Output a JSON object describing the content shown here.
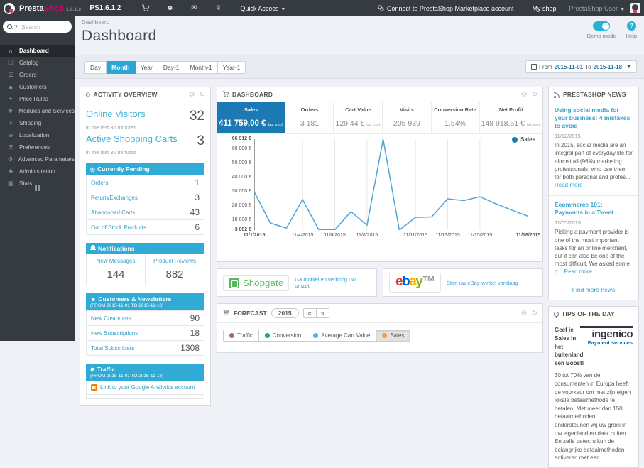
{
  "topbar": {
    "brand_presta": "Presta",
    "brand_shop": "Shop",
    "version": "1.6.1.2",
    "shop_name": "PS1.6.1.2",
    "quick_access": "Quick Access",
    "marketplace_link": "Connect to PrestaShop Marketplace account",
    "my_shop": "My shop",
    "user": "PrestaShop User"
  },
  "sidebar": {
    "search_placeholder": "Search",
    "items": [
      {
        "label": "Dashboard",
        "icon": "⌂"
      },
      {
        "label": "Catalog",
        "icon": "❏"
      },
      {
        "label": "Orders",
        "icon": "☰"
      },
      {
        "label": "Customers",
        "icon": "☻"
      },
      {
        "label": "Price Rules",
        "icon": "✦"
      },
      {
        "label": "Modules and Services",
        "icon": "❖"
      },
      {
        "label": "Shipping",
        "icon": "✈"
      },
      {
        "label": "Localization",
        "icon": "⊕"
      },
      {
        "label": "Preferences",
        "icon": "⚒"
      },
      {
        "label": "Advanced Parameters",
        "icon": "⚙"
      },
      {
        "label": "Administration",
        "icon": "✱"
      },
      {
        "label": "Stats",
        "icon": "▦"
      }
    ]
  },
  "header": {
    "breadcrumb": "Dashboard",
    "title": "Dashboard",
    "demo_mode_label": "Demo mode",
    "help_label": "Help",
    "help_glyph": "?"
  },
  "filters": {
    "buttons": [
      "Day",
      "Month",
      "Year",
      "Day-1",
      "Month-1",
      "Year-1"
    ],
    "active": "Month",
    "date_range": {
      "from_label": "From",
      "from": "2015-11-01",
      "to_label": "To",
      "to": "2015-11-18"
    }
  },
  "activity": {
    "title": "ACTIVITY OVERVIEW",
    "online_visitors": {
      "label": "Online Visitors",
      "value": "32",
      "sub": "in the last 30 minutes"
    },
    "active_carts": {
      "label": "Active Shopping Carts",
      "value": "3",
      "sub": "in the last 30 minutes"
    },
    "pending": {
      "title": "Currently Pending",
      "rows": [
        {
          "label": "Orders",
          "value": "1"
        },
        {
          "label": "Return/Exchanges",
          "value": "3"
        },
        {
          "label": "Abandoned Carts",
          "value": "43"
        },
        {
          "label": "Out of Stock Products",
          "value": "6"
        }
      ]
    },
    "notifications": {
      "title": "Notifications",
      "cols": [
        {
          "label": "New Messages",
          "value": "144"
        },
        {
          "label": "Product Reviews",
          "value": "882"
        }
      ]
    },
    "customers": {
      "title": "Customers & Newsletters",
      "range": "(FROM 2015-11-01 TO 2015-11-18)",
      "rows": [
        {
          "label": "New Customers",
          "value": "90"
        },
        {
          "label": "New Subscriptions",
          "value": "18"
        },
        {
          "label": "Total Subscribers",
          "value": "1308"
        }
      ]
    },
    "traffic": {
      "title": "Traffic",
      "range": "(FROM 2015-11-01 TO 2015-11-18)",
      "link": "Link to your Google Analytics account"
    }
  },
  "dashboard_panel": {
    "title": "DASHBOARD",
    "kpis": [
      {
        "label": "Sales",
        "value": "411 759,00 €",
        "suffix": "tax excl."
      },
      {
        "label": "Orders",
        "value": "3 181"
      },
      {
        "label": "Cart Value",
        "value": "129,44 €",
        "suffix": "tax excl."
      },
      {
        "label": "Visits",
        "value": "205 939"
      },
      {
        "label": "Conversion Rate",
        "value": "1.54%"
      },
      {
        "label": "Net Profit",
        "value": "148 918,51 €",
        "suffix": "tax excl."
      }
    ],
    "legend_label": "Sales"
  },
  "chart_data": {
    "type": "line",
    "title": "Sales",
    "x": [
      "11/1/2015",
      "11/2/2015",
      "11/3/2015",
      "11/4/2015",
      "11/5/2015",
      "11/6/2015",
      "11/7/2015",
      "11/8/2015",
      "11/9/2015",
      "11/10/2015",
      "11/11/2015",
      "11/12/2015",
      "11/13/2015",
      "11/14/2015",
      "11/15/2015",
      "11/16/2015",
      "11/17/2015",
      "11/18/2015"
    ],
    "series": [
      {
        "name": "Sales",
        "values": [
          30000,
          8000,
          4500,
          24500,
          3500,
          3300,
          16000,
          6500,
          66912,
          3082,
          12000,
          12300,
          25000,
          23800,
          26500,
          21500,
          17000,
          12800
        ]
      }
    ],
    "ylim": [
      3082,
      66912
    ],
    "y_ticks": [
      {
        "value": 66912,
        "label": "66 912 €",
        "bold": true
      },
      {
        "value": 60000,
        "label": "60 000 €"
      },
      {
        "value": 50000,
        "label": "50 000 €"
      },
      {
        "value": 40000,
        "label": "40 000 €"
      },
      {
        "value": 30000,
        "label": "30 000 €"
      },
      {
        "value": 20000,
        "label": "20 000 €"
      },
      {
        "value": 10000,
        "label": "10 000 €"
      },
      {
        "value": 3082,
        "label": "3 082 €",
        "bold": true
      }
    ],
    "x_ticks": [
      {
        "index": 0,
        "label": "11/1/2015",
        "bold": true
      },
      {
        "index": 3,
        "label": "11/4/2015"
      },
      {
        "index": 5,
        "label": "11/6/2015"
      },
      {
        "index": 7,
        "label": "11/8/2015"
      },
      {
        "index": 10,
        "label": "11/11/2015"
      },
      {
        "index": 12,
        "label": "11/13/2015"
      },
      {
        "index": 14,
        "label": "11/15/2015"
      },
      {
        "index": 17,
        "label": "11/18/2015",
        "bold": true
      }
    ],
    "legend": [
      "Sales"
    ],
    "legend_position": "top-right",
    "grid": "vertical",
    "line_color": "#4aa6d8"
  },
  "banners": {
    "shopgate": {
      "brand": "Shopgate",
      "link": "Ga mobiel en verhoog uw omzet"
    },
    "ebay": {
      "b1": "e",
      "b2": "b",
      "b3": "a",
      "b4": "y",
      "tm": "™",
      "link": "Start uw eBay-winkel vandaag"
    }
  },
  "forecast": {
    "title": "FORECAST",
    "year": "2015",
    "prev": "«",
    "next": "»",
    "legend": [
      {
        "label": "Traffic",
        "color": "#a55ca5"
      },
      {
        "label": "Conversion",
        "color": "#13a89e"
      },
      {
        "label": "Average Cart Value",
        "color": "#3fc0e0"
      },
      {
        "label": "Sales",
        "color": "#f59d3f",
        "active": true
      }
    ]
  },
  "news": {
    "title": "PRESTASHOP NEWS",
    "articles": [
      {
        "title": "Using social media for your business: 4 mistakes to avoid",
        "date": "11/12/2015",
        "body": "In 2015, social media are an integral part of everyday life for almost all (96%) marketing professionals, who use them for both personal and profes... ",
        "read_more": "Read more"
      },
      {
        "title": "Ecommerce 101: Payments in a Tweet",
        "date": "11/05/2015",
        "body": "Picking a payment provider is one of the most important tasks for an online merchant, but it can also be one of the most difficult. We asked some o... ",
        "read_more": "Read more"
      }
    ],
    "more": "Find more news"
  },
  "tips": {
    "title": "TIPS OF THE DAY",
    "headline": "Geef je Sales in het buitenland een Boost!",
    "logo_text": "ingenico",
    "logo_sub": "Payment services",
    "body": "30 tot 70% van de consumenten in Europa heeft de voorkeur om met zijn eigen lokale betaalmethode te betalen. Met meer dan 150 betaalmethoden, ondersteunen wij uw groei in uw eigenland en daar buiten. En zelfs beter: u kun de belangrijke betaalmethoden activeren met een..."
  },
  "colors": {
    "topbar_bg": "#363a41",
    "accent_cyan": "#26b3d3",
    "section_header_blue": "#2fabd6",
    "link_blue": "#34a0c6",
    "kpi_active_blue": "#1b7ab3",
    "brand_pink": "#df0067",
    "chart_line": "#4aa6d8",
    "legend_dot": "#1f77b4"
  }
}
